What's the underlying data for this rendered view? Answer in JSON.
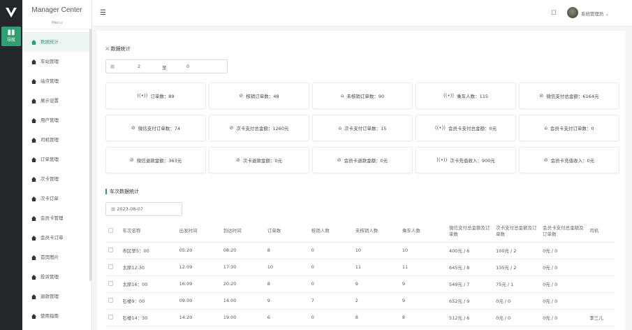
{
  "rail": {
    "menu_label": "导航",
    "menu_icon": "grid-icon"
  },
  "sidebar": {
    "brand": "Manager Center",
    "sub": "Menu",
    "items": [
      {
        "label": "数据统计",
        "icon": "home-icon",
        "active": true
      },
      {
        "label": "车站管理",
        "icon": "home-icon"
      },
      {
        "label": "站点管理",
        "icon": "home-icon"
      },
      {
        "label": "展示设置",
        "icon": "home-icon"
      },
      {
        "label": "用户管理",
        "icon": "home-icon"
      },
      {
        "label": "司机管理",
        "icon": "home-icon"
      },
      {
        "label": "订单管理",
        "icon": "home-icon"
      },
      {
        "label": "次卡管理",
        "icon": "home-icon"
      },
      {
        "label": "次卡订单",
        "icon": "home-icon"
      },
      {
        "label": "会员卡管理",
        "icon": "home-icon"
      },
      {
        "label": "会员卡订单",
        "icon": "home-icon"
      },
      {
        "label": "首页图片",
        "icon": "home-icon"
      },
      {
        "label": "投诉管理",
        "icon": "home-icon"
      },
      {
        "label": "退款管理",
        "icon": "home-icon"
      },
      {
        "label": "使用指南",
        "icon": "home-icon"
      }
    ]
  },
  "header": {
    "user_name": "系统管理员"
  },
  "stats": {
    "title": "数据统计",
    "range_start": "2",
    "range_sep": "至",
    "range_end": "0",
    "cards": [
      {
        "label": "订单数：89",
        "icon": "signal-icon"
      },
      {
        "label": "核销订单数：48",
        "icon": "check-circle-icon"
      },
      {
        "label": "未核销订单数：90",
        "icon": "home-icon"
      },
      {
        "label": "乘车人数：115",
        "icon": "signal-icon"
      },
      {
        "label": "微信支付总金额：6164元",
        "icon": "check-circle-icon"
      },
      {
        "label": "微信支付订单数：74",
        "icon": "check-circle-icon"
      },
      {
        "label": "次卡支付总金额：1260元",
        "icon": "check-circle-icon"
      },
      {
        "label": "次卡支付订单数：15",
        "icon": "home-icon"
      },
      {
        "label": "会员卡支付总金额：0元",
        "icon": "signal-icon"
      },
      {
        "label": "会员卡支付订单数：0",
        "icon": "home-icon"
      },
      {
        "label": "微信退款金额：363元",
        "icon": "check-circle-icon"
      },
      {
        "label": "次卡退款金额：0元",
        "icon": "check-circle-icon"
      },
      {
        "label": "会员卡退款金额：0元",
        "icon": "check-circle-icon"
      },
      {
        "label": "次卡充值收入：900元",
        "icon": "signal-icon"
      },
      {
        "label": "会员卡充值收入：0元",
        "icon": "check-circle-icon"
      }
    ]
  },
  "trips": {
    "title": "车次数据统计",
    "date": "2023-08-07",
    "columns": [
      "车次名称",
      "出发时间",
      "到达时间",
      "订单数",
      "核销人数",
      "未核销人数",
      "乘车人数",
      "微信支付总金额及订单数",
      "次卡支付总金额及订单数",
      "会员卡支付总金额及订单数",
      "司机"
    ],
    "rows": [
      [
        "市区早5：00",
        "05:20",
        "08:20",
        "8",
        "0",
        "10",
        "10",
        "400元 / 6",
        "100元 / 2",
        "0元 / 0",
        ""
      ],
      [
        "太原12:30",
        "12:09",
        "17:30",
        "10",
        "0",
        "11",
        "11",
        "645元 / 8",
        "135元 / 2",
        "0元 / 0",
        ""
      ],
      [
        "太原16：00",
        "16:09",
        "20:20",
        "8",
        "0",
        "9",
        "9",
        "549元 / 7",
        "75元 / 1",
        "0元 / 0",
        ""
      ],
      [
        "石楼9：00",
        "09:00",
        "14:00",
        "9",
        "7",
        "2",
        "9",
        "652元 / 9",
        "0元 / 0",
        "0元 / 0",
        ""
      ],
      [
        "石楼14：30",
        "14:20",
        "19:00",
        "6",
        "0",
        "8",
        "8",
        "512元 / 6",
        "0元 / 0",
        "0元 / 0",
        "李三儿"
      ]
    ]
  }
}
